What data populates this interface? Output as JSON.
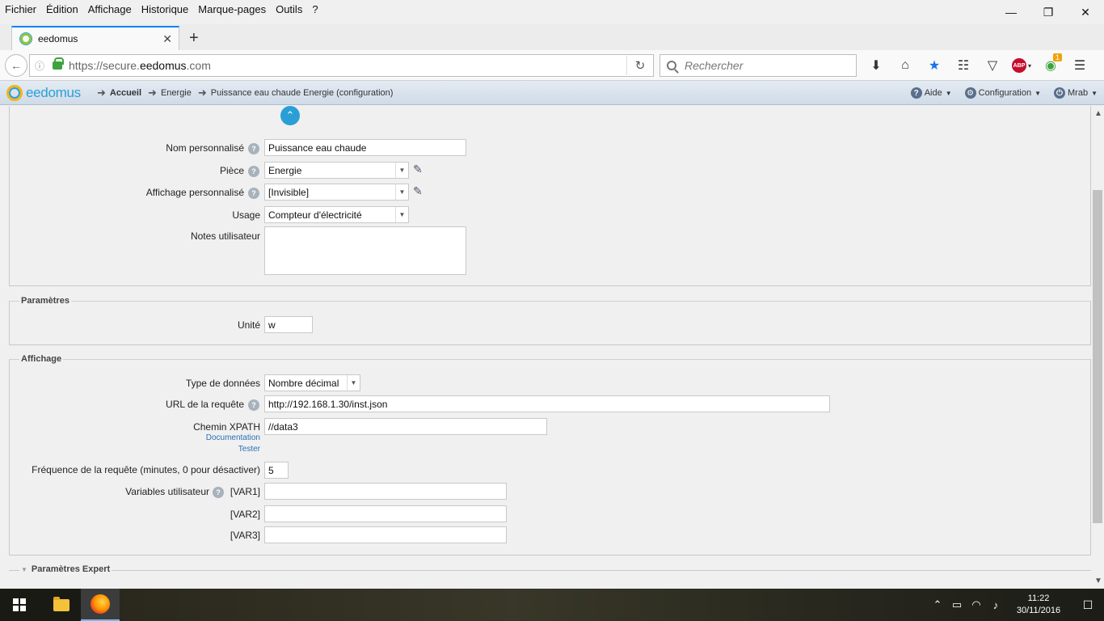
{
  "menubar": {
    "items": [
      "Fichier",
      "Édition",
      "Affichage",
      "Historique",
      "Marque-pages",
      "Outils",
      "?"
    ]
  },
  "window_controls": {
    "minimize": "—",
    "restore": "❐",
    "close": "✕"
  },
  "tab": {
    "title": "eedomus",
    "close": "✕",
    "new": "+"
  },
  "navbar": {
    "url_prefix": "https://secure.",
    "url_domain": "eedomus",
    "url_suffix": ".com",
    "search_placeholder": "Rechercher",
    "badge_count": "1"
  },
  "appbar": {
    "logo": "eedomus",
    "breadcrumb": [
      "Accueil",
      "Energie",
      "Puissance eau chaude Energie (configuration)"
    ],
    "menu": {
      "help": "Aide",
      "config": "Configuration",
      "user": "Mrab"
    }
  },
  "form": {
    "name_label": "Nom personnalisé",
    "name_value": "Puissance eau chaude",
    "room_label": "Pièce",
    "room_value": "Energie",
    "display_label": "Affichage personnalisé",
    "display_value": "[Invisible]",
    "usage_label": "Usage",
    "usage_value": "Compteur d'électricité",
    "notes_label": "Notes utilisateur"
  },
  "parametres": {
    "legend": "Paramètres",
    "unit_label": "Unité",
    "unit_value": "w"
  },
  "affichage": {
    "legend": "Affichage",
    "datatype_label": "Type de données",
    "datatype_value": "Nombre décimal",
    "url_label": "URL de la requête",
    "url_value": "http://192.168.1.30/inst.json",
    "xpath_label": "Chemin XPATH",
    "xpath_value": "//data3",
    "doc_link": "Documentation",
    "test_link": "Tester",
    "freq_label": "Fréquence de la requête (minutes, 0 pour désactiver)",
    "freq_value": "5",
    "vars_label": "Variables utilisateur",
    "var1": "[VAR1]",
    "var2": "[VAR2]",
    "var3": "[VAR3]"
  },
  "expert": {
    "legend": "Paramètres Expert"
  },
  "taskbar": {
    "time": "11:22",
    "date": "30/11/2016"
  }
}
